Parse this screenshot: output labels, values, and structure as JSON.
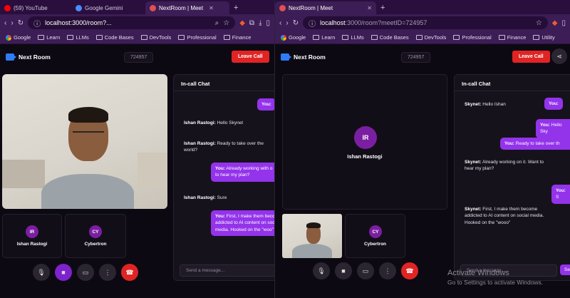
{
  "left_window": {
    "tabs": [
      {
        "label": "(59) YouTube",
        "color": "#ff0000",
        "active": false
      },
      {
        "label": "Google Gemini",
        "color": "#4a8cff",
        "active": false
      },
      {
        "label": "NextRoom | Meet",
        "color": "#e05050",
        "active": true
      }
    ],
    "address": {
      "host": "localhost:3000/room?...",
      "path": ""
    },
    "bookmarks": [
      "Google",
      "Learn",
      "LLMs",
      "Code Bases",
      "DevTools",
      "Professional",
      "Finance"
    ],
    "app_name": "Next Room",
    "meeting_id": "724957",
    "leave_label": "Leave Call",
    "participants": [
      {
        "initials": "IR",
        "name": "Ishan Rastogi"
      },
      {
        "initials": "CY",
        "name": "Cybertron"
      }
    ],
    "chat": {
      "title": "In-call Chat",
      "messages": [
        {
          "from": "me",
          "sender": "You:",
          "text": ""
        },
        {
          "from": "them",
          "sender": "Ishan Rastogi:",
          "text": "Hello Skynet"
        },
        {
          "from": "them",
          "sender": "Ishan Rastogi:",
          "text": "Ready to take over the world?"
        },
        {
          "from": "me",
          "sender": "You:",
          "text": "Already working with o\nto hear my plan?"
        },
        {
          "from": "them",
          "sender": "Ishan Rastogi:",
          "text": "Sure"
        },
        {
          "from": "me",
          "sender": "You:",
          "text": "First, I make them becom\naddicted to AI content on socia\nmedia. Hooked on the \"woo\""
        }
      ],
      "placeholder": "Send a message..."
    }
  },
  "right_window": {
    "tabs": [
      {
        "label": "NextRoom | Meet",
        "color": "#e05050",
        "active": true
      }
    ],
    "address": {
      "host": "localhost",
      "path": ":3000/room?meetID=724957"
    },
    "bookmarks": [
      "Google",
      "Learn",
      "LLMs",
      "Code Bases",
      "DevTools",
      "Professional",
      "Finance",
      "Utility"
    ],
    "app_name": "Next Room",
    "meeting_id": "724957",
    "leave_label": "Leave Call",
    "main_participant": {
      "initials": "IR",
      "name": "Ishan Rastogi"
    },
    "participants": [
      {
        "initials": "CY",
        "name": "Cybertron"
      }
    ],
    "chat": {
      "title": "In-call Chat",
      "messages": [
        {
          "from": "me",
          "sender": "You:",
          "text": ""
        },
        {
          "from": "them",
          "sender": "Skynet:",
          "text": "Hello Ishan"
        },
        {
          "from": "me",
          "sender": "You:",
          "text": "Hello Sky"
        },
        {
          "from": "me",
          "sender": "You:",
          "text": "Ready to take over th"
        },
        {
          "from": "them",
          "sender": "Skynet:",
          "text": "Already working on it. Want to hear my plan?"
        },
        {
          "from": "me",
          "sender": "You:",
          "text": "S"
        },
        {
          "from": "them",
          "sender": "Skynet:",
          "text": "First, I make them become addicted to AI content on social media. Hooked on the \"wooo\""
        }
      ],
      "placeholder": "Send a message...",
      "send_label": "Se"
    }
  },
  "watermark": {
    "line1": "Activate Windows",
    "line2": "Go to Settings to activate Windows."
  },
  "colors": {
    "accent": "#9333ea",
    "leave": "#e02424",
    "avatar": "#7b1fa2",
    "chrome": "#3c1d55"
  }
}
